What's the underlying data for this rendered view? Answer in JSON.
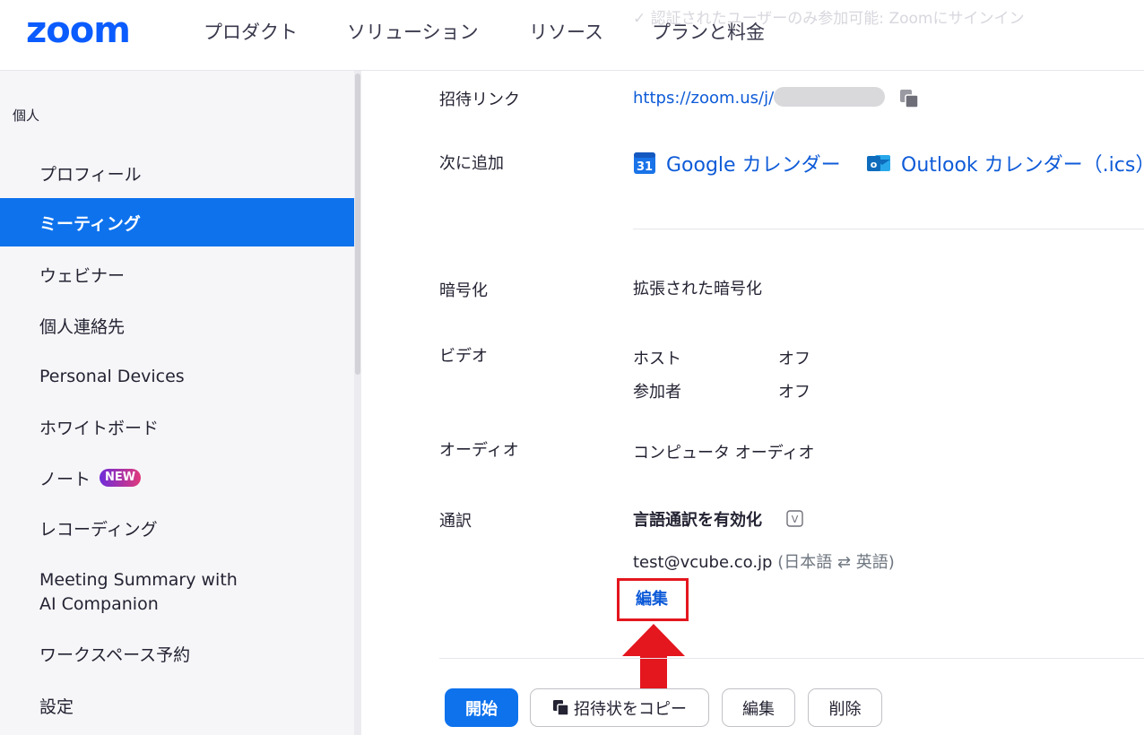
{
  "header": {
    "logo": "zoom",
    "nav": [
      "プロダクト",
      "ソリューション",
      "リソース",
      "プランと料金"
    ],
    "ghost_text": "✓ 認証されたユーザーのみ参加可能: Zoomにサインイン"
  },
  "sidebar": {
    "section_title": "個人",
    "items": [
      {
        "label": "プロフィール"
      },
      {
        "label": "ミーティング",
        "active": true
      },
      {
        "label": "ウェビナー"
      },
      {
        "label": "個人連絡先"
      },
      {
        "label": "Personal Devices"
      },
      {
        "label": "ホワイトボード"
      },
      {
        "label": "ノート",
        "badge": "NEW"
      },
      {
        "label": "レコーディング"
      },
      {
        "label": "Meeting Summary with AI Companion"
      },
      {
        "label": "ワークスペース予約"
      },
      {
        "label": "設定"
      }
    ]
  },
  "meeting": {
    "invite_link_label": "招待リンク",
    "invite_link_value": "https://zoom.us/j/",
    "add_to_label": "次に追加",
    "google_calendar": "Google カレンダー",
    "google_icon_text": "31",
    "outlook_calendar": "Outlook カレンダー（.ics）",
    "outlook_icon_text": "o",
    "encryption_label": "暗号化",
    "encryption_value": "拡張された暗号化",
    "video_label": "ビデオ",
    "video_host_label": "ホスト",
    "video_host_value": "オフ",
    "video_participant_label": "参加者",
    "video_participant_value": "オフ",
    "audio_label": "オーディオ",
    "audio_value": "コンピュータ オーディオ",
    "interpretation_label": "通訳",
    "interpretation_title": "言語通訳を有効化",
    "interpretation_icon_text": "V",
    "interpreter_email": "test@vcube.co.jp",
    "interpreter_languages": "(日本語 ⇄ 英語)",
    "edit_link": "編集"
  },
  "actions": {
    "start": "開始",
    "copy_invite": "招待状をコピー",
    "edit": "編集",
    "delete": "削除"
  },
  "colors": {
    "brand": "#0b5cff",
    "active_sidebar": "#0e72ed",
    "link": "#0e5bd8",
    "highlight": "#e4161e"
  }
}
